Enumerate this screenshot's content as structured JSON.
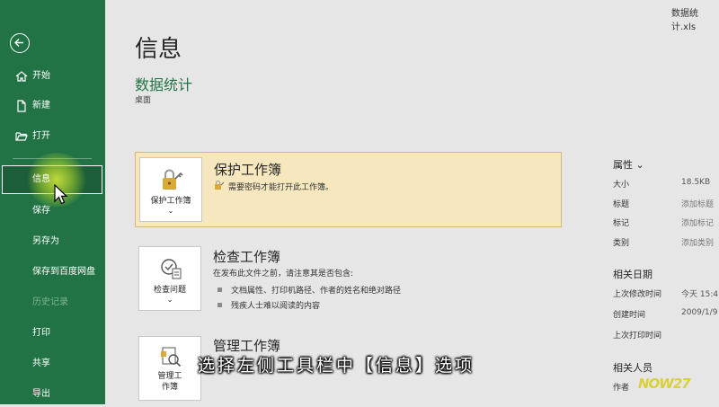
{
  "window": {
    "filename": "数据统计.xls"
  },
  "sidebar": {
    "items": [
      {
        "label": "开始",
        "icon": "home-icon"
      },
      {
        "label": "新建",
        "icon": "new-document-icon"
      },
      {
        "label": "打开",
        "icon": "open-folder-icon"
      },
      {
        "label": "信息",
        "selected": true
      },
      {
        "label": "保存"
      },
      {
        "label": "另存为"
      },
      {
        "label": "保存到百度网盘"
      },
      {
        "label": "历史记录",
        "disabled": true
      },
      {
        "label": "打印"
      },
      {
        "label": "共享"
      },
      {
        "label": "导出"
      }
    ]
  },
  "main": {
    "title": "信息",
    "workbook_name": "数据统计",
    "workbook_location": "桌面",
    "protect": {
      "button_label": "保护工作簿",
      "title": "保护工作簿",
      "description": "需要密码才能打开此工作簿。"
    },
    "inspect": {
      "button_label": "检查问题",
      "title": "检查工作簿",
      "description": "在发布此文件之前，请注意其是否包含:",
      "bullets": [
        "文档属性、打印机路径、作者的姓名和绝对路径",
        "残疾人士难以阅读的内容"
      ]
    },
    "manage": {
      "button_label_line1": "管理工",
      "button_label_line2": "作簿",
      "title": "管理工作簿"
    }
  },
  "properties": {
    "header": "属性",
    "rows": [
      {
        "key": "大小",
        "value": "18.5KB"
      },
      {
        "key": "标题",
        "value": "添加标题"
      },
      {
        "key": "标记",
        "value": "添加标记"
      },
      {
        "key": "类别",
        "value": "添加类别"
      }
    ],
    "dates_header": "相关日期",
    "dates": [
      {
        "key": "上次修改时间",
        "value": "今天 15:4"
      },
      {
        "key": "创建时间",
        "value": "2009/1/9"
      },
      {
        "key": "上次打印时间",
        "value": ""
      }
    ],
    "people_header": "相关人员",
    "people": [
      {
        "key": "作者",
        "value": ""
      }
    ]
  },
  "overlay": {
    "subtitle": "选择左侧工具栏中【信息】选项",
    "watermark": "NOW27"
  },
  "colors": {
    "sidebar": "#217346",
    "accent": "#217346",
    "protect_bg": "#f6e7bf"
  }
}
